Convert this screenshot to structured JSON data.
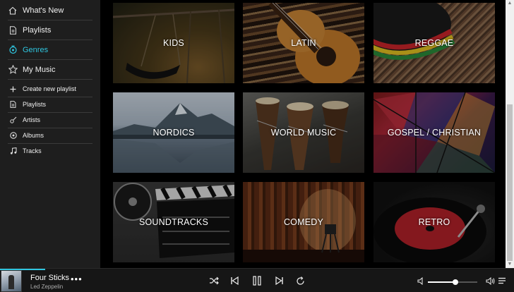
{
  "sidebar": {
    "primary": [
      {
        "label": "What's New",
        "icon": "home-icon"
      },
      {
        "label": "Playlists",
        "icon": "playlist-doc-icon"
      },
      {
        "label": "Genres",
        "icon": "genres-icon",
        "active": true
      },
      {
        "label": "My Music",
        "icon": "star-icon"
      }
    ],
    "secondary": [
      {
        "label": "Create new playlist",
        "icon": "plus-icon"
      },
      {
        "label": "Playlists",
        "icon": "playlist-doc-icon"
      },
      {
        "label": "Artists",
        "icon": "guitar-icon"
      },
      {
        "label": "Albums",
        "icon": "disc-icon"
      },
      {
        "label": "Tracks",
        "icon": "note-icon"
      }
    ]
  },
  "genres": [
    {
      "label": "KIDS"
    },
    {
      "label": "LATIN"
    },
    {
      "label": "REGGAE"
    },
    {
      "label": "NORDICS"
    },
    {
      "label": "WORLD MUSIC"
    },
    {
      "label": "GOSPEL / CHRISTIAN"
    },
    {
      "label": "SOUNDTRACKS"
    },
    {
      "label": "COMEDY"
    },
    {
      "label": "RETRO"
    }
  ],
  "player": {
    "title": "Four Sticks",
    "artist": "Led Zeppelin",
    "more": "•••",
    "controls": [
      "shuffle-icon",
      "previous-icon",
      "pause-icon",
      "next-icon",
      "repeat-icon"
    ],
    "volume": 0.55,
    "track_progress": 0.09
  },
  "colors": {
    "accent": "#2fc6e0",
    "sidebar_bg": "#1e1e1e",
    "main_bg": "#000000",
    "player_bg": "#161616"
  }
}
